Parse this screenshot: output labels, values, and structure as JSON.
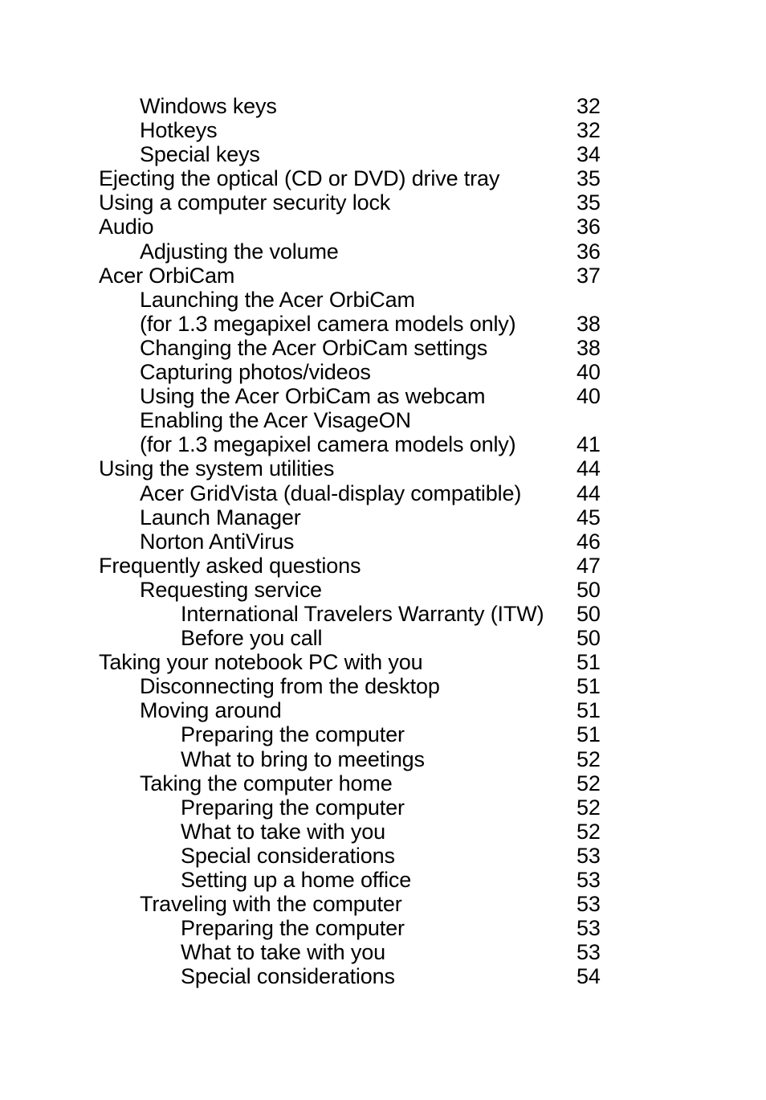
{
  "document": {
    "type": "table-of-contents",
    "page_background": "#ffffff",
    "text_color": "#000000"
  },
  "toc": {
    "entries": [
      {
        "title": "Windows keys",
        "page": "32",
        "level": 1
      },
      {
        "title": "Hotkeys",
        "page": "32",
        "level": 1
      },
      {
        "title": "Special keys",
        "page": "34",
        "level": 1
      },
      {
        "title": "Ejecting the optical (CD or DVD) drive tray",
        "page": "35",
        "level": 0
      },
      {
        "title": "Using a computer security lock",
        "page": "35",
        "level": 0
      },
      {
        "title": "Audio",
        "page": "36",
        "level": 0
      },
      {
        "title": "Adjusting the volume",
        "page": "36",
        "level": 1
      },
      {
        "title": "Acer OrbiCam",
        "page": "37",
        "level": 0
      },
      {
        "title": "Launching the Acer OrbiCam",
        "page": "",
        "level": 1
      },
      {
        "title": "(for 1.3 megapixel camera models only)",
        "page": "38",
        "level": 1
      },
      {
        "title": "Changing the Acer OrbiCam settings",
        "page": "38",
        "level": 1
      },
      {
        "title": "Capturing photos/videos",
        "page": "40",
        "level": 1
      },
      {
        "title": "Using the Acer OrbiCam as webcam",
        "page": "40",
        "level": 1
      },
      {
        "title": "Enabling the Acer VisageON",
        "page": "",
        "level": 1
      },
      {
        "title": "(for 1.3 megapixel camera models only)",
        "page": "41",
        "level": 1
      },
      {
        "title": "Using the system utilities",
        "page": "44",
        "level": 0
      },
      {
        "title": "Acer GridVista (dual-display compatible)",
        "page": "44",
        "level": 1
      },
      {
        "title": "Launch Manager",
        "page": "45",
        "level": 1
      },
      {
        "title": "Norton AntiVirus",
        "page": "46",
        "level": 1
      },
      {
        "title": "Frequently asked questions",
        "page": "47",
        "level": 0
      },
      {
        "title": "Requesting service",
        "page": "50",
        "level": 1
      },
      {
        "title": "International Travelers Warranty (ITW)",
        "page": "50",
        "level": 2
      },
      {
        "title": "Before you call",
        "page": "50",
        "level": 2
      },
      {
        "title": "Taking your notebook PC with you",
        "page": "51",
        "level": 0
      },
      {
        "title": "Disconnecting from the desktop",
        "page": "51",
        "level": 1
      },
      {
        "title": "Moving around",
        "page": "51",
        "level": 1
      },
      {
        "title": "Preparing the computer",
        "page": "51",
        "level": 2
      },
      {
        "title": "What to bring to meetings",
        "page": "52",
        "level": 2
      },
      {
        "title": "Taking the computer home",
        "page": "52",
        "level": 1
      },
      {
        "title": "Preparing the computer",
        "page": "52",
        "level": 2
      },
      {
        "title": "What to take with you",
        "page": "52",
        "level": 2
      },
      {
        "title": "Special considerations",
        "page": "53",
        "level": 2
      },
      {
        "title": "Setting up a home office",
        "page": "53",
        "level": 2
      },
      {
        "title": "Traveling with the computer",
        "page": "53",
        "level": 1
      },
      {
        "title": "Preparing the computer",
        "page": "53",
        "level": 2
      },
      {
        "title": "What to take with you",
        "page": "53",
        "level": 2
      },
      {
        "title": "Special considerations",
        "page": "54",
        "level": 2
      }
    ]
  }
}
